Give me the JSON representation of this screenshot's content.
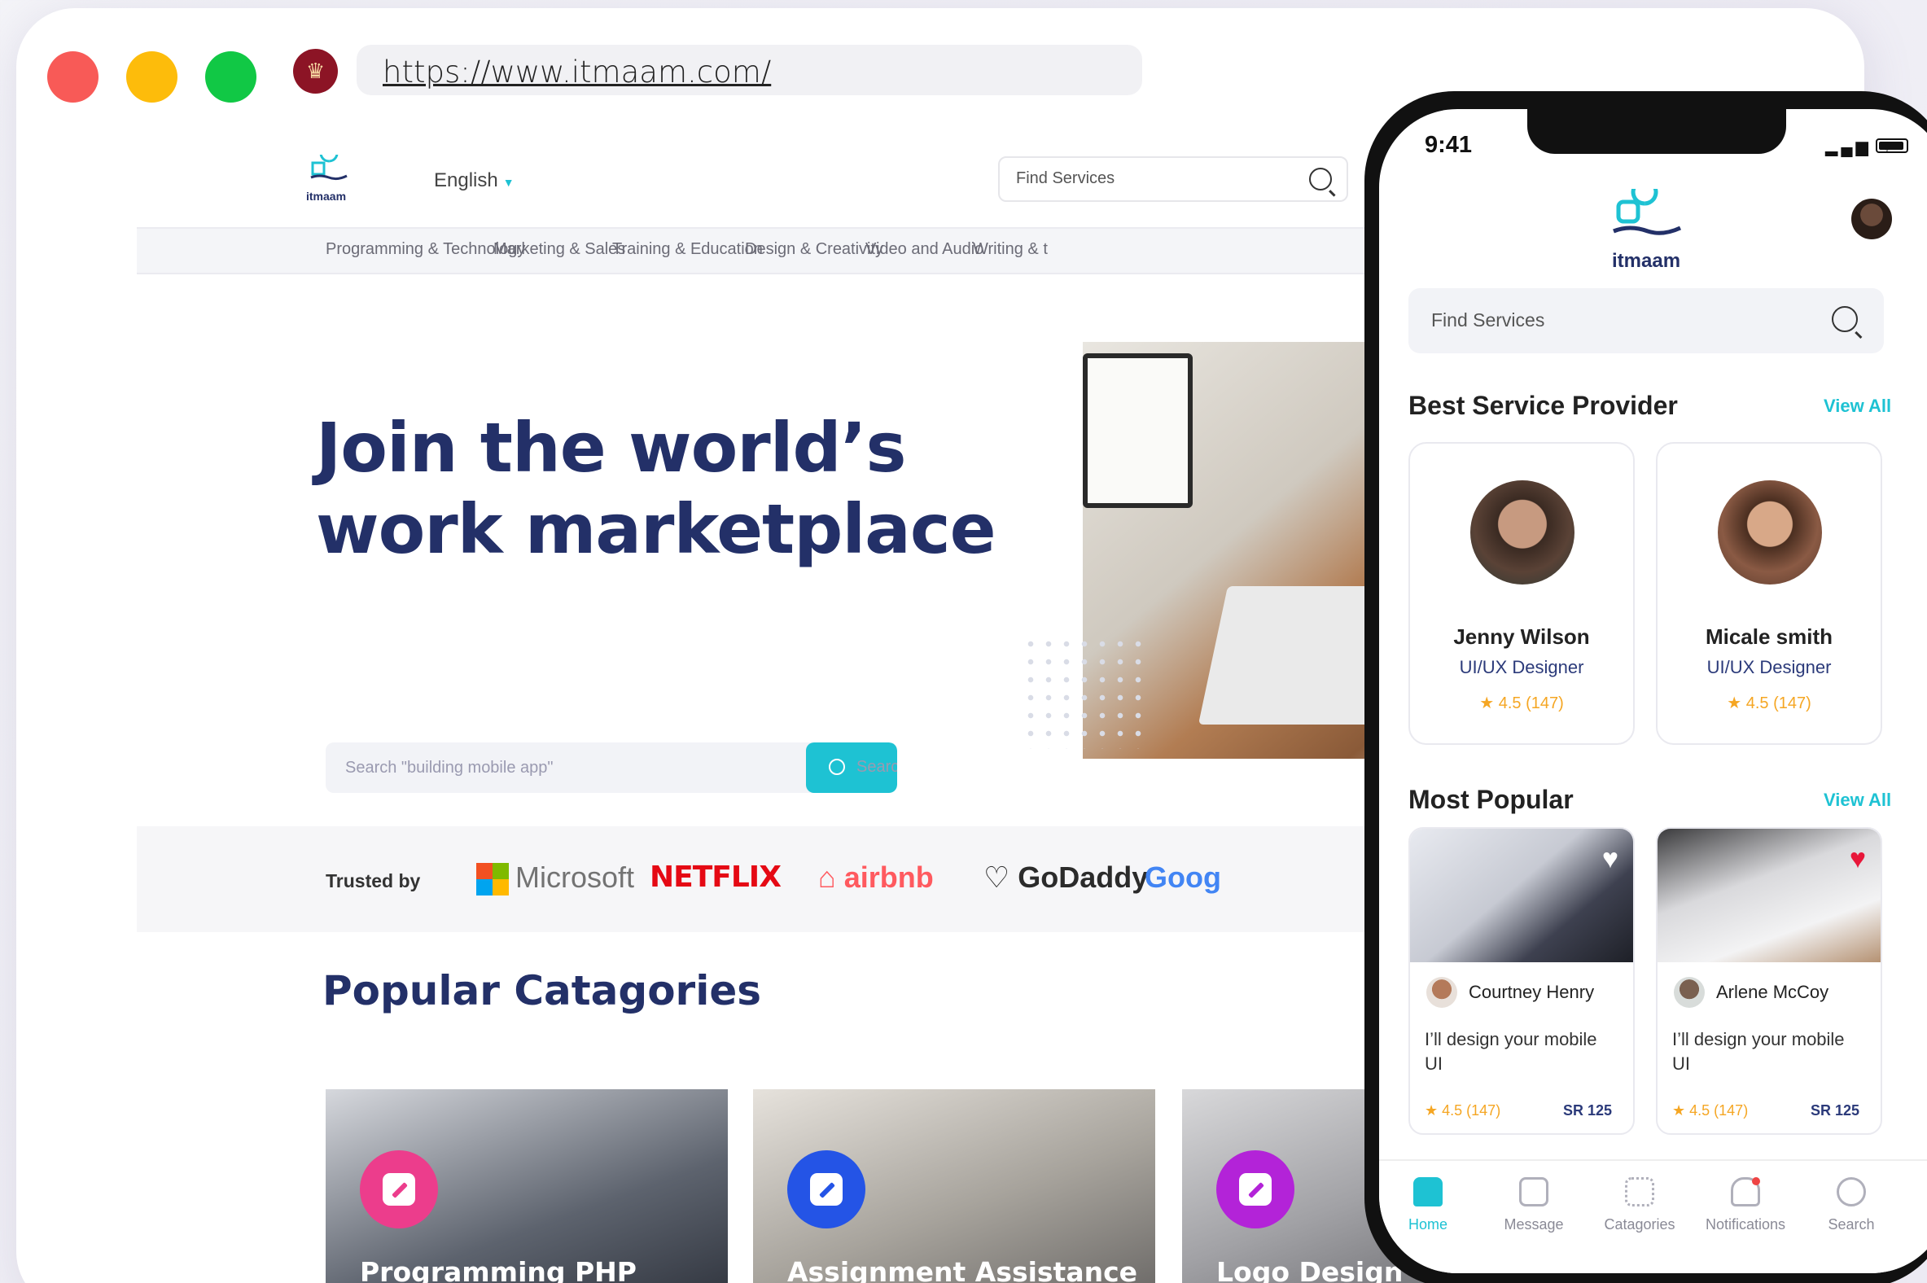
{
  "browser": {
    "url": "https://www.itmaam.com/"
  },
  "header": {
    "logo_text": "itmaam",
    "language": "English",
    "search_placeholder": "Find Services"
  },
  "categories_nav": [
    "Programming & Technology",
    "Marketing & Sales",
    "Training & Education",
    "Design & Creativity",
    "Video and Audio",
    "Writing & t"
  ],
  "hero": {
    "title_line1": "Join the world’s",
    "title_line2": "work marketplace",
    "search_placeholder": "Search \"building mobile app\"",
    "search_button": "Search"
  },
  "trusted": {
    "label": "Trusted by",
    "brands": [
      "Microsoft",
      "NETFLIX",
      "airbnb",
      "GoDaddy",
      "Goog"
    ]
  },
  "popular": {
    "title": "Popular Catagories",
    "cards": [
      {
        "name": "Programming PHP",
        "icon_color": "#ec3d8c",
        "bg": "#3a3f4a"
      },
      {
        "name": "Assignment Assistance",
        "icon_color": "#2454e6",
        "bg": "#8c8f96"
      },
      {
        "name": "Logo Design",
        "icon_color": "#b323d8",
        "bg": "#9a9a9c"
      }
    ]
  },
  "phone": {
    "status_time": "9:41",
    "logo_text": "itmaam",
    "search_placeholder": "Find Services",
    "best_provider": {
      "title": "Best Service Provider",
      "view_all": "View All",
      "items": [
        {
          "name": "Jenny Wilson",
          "role": "UI/UX Designer",
          "rating": "★ 4.5 (147)"
        },
        {
          "name": "Micale smith",
          "role": "UI/UX Designer",
          "rating": "★ 4.5 (147)"
        }
      ]
    },
    "most_popular": {
      "title": "Most Popular",
      "view_all": "View All",
      "items": [
        {
          "seller": "Courtney Henry",
          "title": "I’ll design your mobile UI",
          "rating": "★ 4.5 (147)",
          "price": "SR 125",
          "favorite": false
        },
        {
          "seller": "Arlene McCoy",
          "title": "I’ll design your mobile UI",
          "rating": "★ 4.5 (147)",
          "price": "SR 125",
          "favorite": true
        }
      ]
    },
    "tabs": [
      "Home",
      "Message",
      "Catagories",
      "Notifications",
      "Search"
    ],
    "active_tab": "Home"
  },
  "colors": {
    "accent": "#1ec2d3",
    "navy": "#233068",
    "star": "#f5a623"
  }
}
